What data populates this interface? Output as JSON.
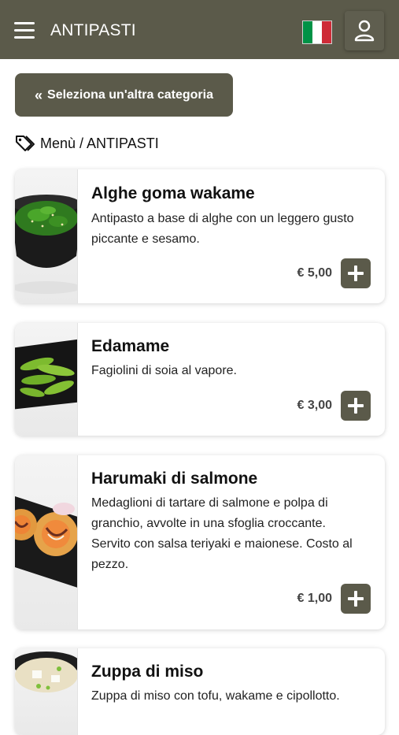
{
  "header": {
    "title": "ANTIPASTI",
    "menu_icon": "hamburger-menu-icon",
    "language_flag": "italy-flag-icon",
    "user_icon": "user-icon",
    "flag_colors": [
      "#009246",
      "#ffffff",
      "#ce2b37"
    ],
    "bar_color": "#5b5a4a"
  },
  "category_button": {
    "icon": "double-chevron-left-icon",
    "label": "Seleziona un'altra categoria"
  },
  "breadcrumb": {
    "icon": "tags-icon",
    "text": "Menù / ANTIPASTI"
  },
  "products": [
    {
      "name": "Alghe goma wakame",
      "description": "Antipasto a base di alghe con un leggero gusto piccante e sesamo.",
      "price": "€ 5,00",
      "add_icon": "plus-icon"
    },
    {
      "name": "Edamame",
      "description": "Fagiolini di soia al vapore.",
      "price": "€ 3,00",
      "add_icon": "plus-icon"
    },
    {
      "name": "Harumaki di salmone",
      "description": "Medaglioni di tartare di salmone e polpa di granchio, avvolte in una sfoglia croccante. Servito con salsa teriyaki e maionese. Costo al pezzo.",
      "price": "€ 1,00",
      "add_icon": "plus-icon"
    },
    {
      "name": "Zuppa di miso",
      "description": "Zuppa di miso con tofu, wakame e cipollotto.",
      "price": "",
      "add_icon": "plus-icon"
    }
  ]
}
